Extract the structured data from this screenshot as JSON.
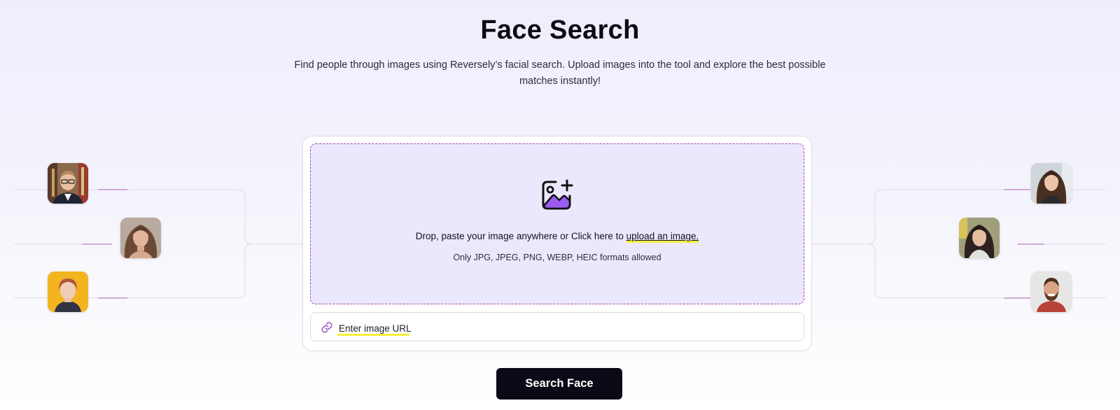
{
  "header": {
    "title": "Face Search",
    "subtitle": "Find people through images using Reversely’s facial search. Upload images into the tool and explore the best possible matches instantly!"
  },
  "upload": {
    "icon": "add-image-icon",
    "text_prefix": "Drop, paste your image anywhere or Click here to ",
    "link_label": "upload an image.",
    "formats": "Only JPG, JPEG, PNG, WEBP, HEIC formats allowed"
  },
  "url_input": {
    "icon": "link-icon",
    "placeholder": "Enter image URL",
    "value": ""
  },
  "search_button": {
    "label": "Search Face"
  },
  "avatars": {
    "left": [
      "man-glasses-avatar",
      "woman-brown-hair-avatar",
      "woman-yellow-background-avatar"
    ],
    "right": [
      "woman-long-hair-avatar",
      "woman-dark-hair-avatar",
      "man-beard-avatar"
    ]
  },
  "colors": {
    "accent": "#a6479e",
    "dropzone_bg": "#ebe8fd",
    "highlight": "#f5ef3a",
    "button_bg": "#0a0a16"
  }
}
